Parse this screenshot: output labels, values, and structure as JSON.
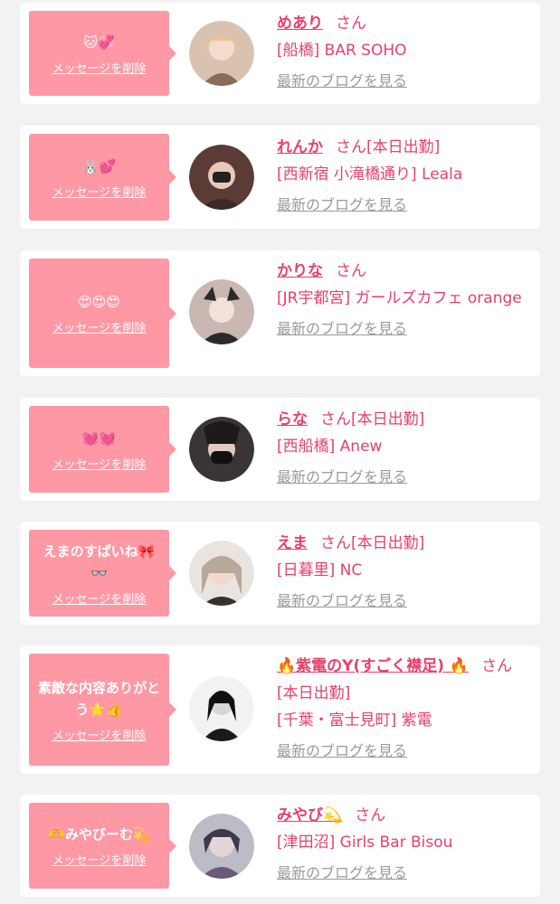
{
  "delete_label": "メッセージを削除",
  "blog_label": "最新のブログを見る",
  "san_label": "さん",
  "colors": {
    "accent": "#e8406c",
    "bubble": "#fd98a4",
    "background": "#f2f2f2"
  },
  "cards": [
    {
      "message": "🐱💞",
      "name": "めあり",
      "status": "",
      "shop": "[船橋] BAR SOHO"
    },
    {
      "message": "🐰💕",
      "name": "れんか",
      "status": "[本日出勤]",
      "shop": "[西新宿 小滝橋通り] Leala"
    },
    {
      "message": "😍😍😍",
      "name": "かりな",
      "status": "",
      "shop": "[JR宇都宮] ガールズカフェ orange"
    },
    {
      "message": "💓💓",
      "name": "らな",
      "status": "[本日出勤]",
      "shop": "[西船橋] Anew"
    },
    {
      "message": "えまのすぱいね🎀 👓",
      "name": "えま",
      "status": "[本日出勤]",
      "shop": "[日暮里] NC"
    },
    {
      "message": "素敵な内容ありがとう⭐👍",
      "name": "🔥紫電のY(すごく襟足) 🔥",
      "status": "[本日出勤]",
      "shop": "[千葉・富士見町] 紫電"
    },
    {
      "message": "🫶みやびーむ💫",
      "name": "みやび💫",
      "status": "",
      "shop": "[津田沼] Girls Bar Bisou"
    }
  ]
}
